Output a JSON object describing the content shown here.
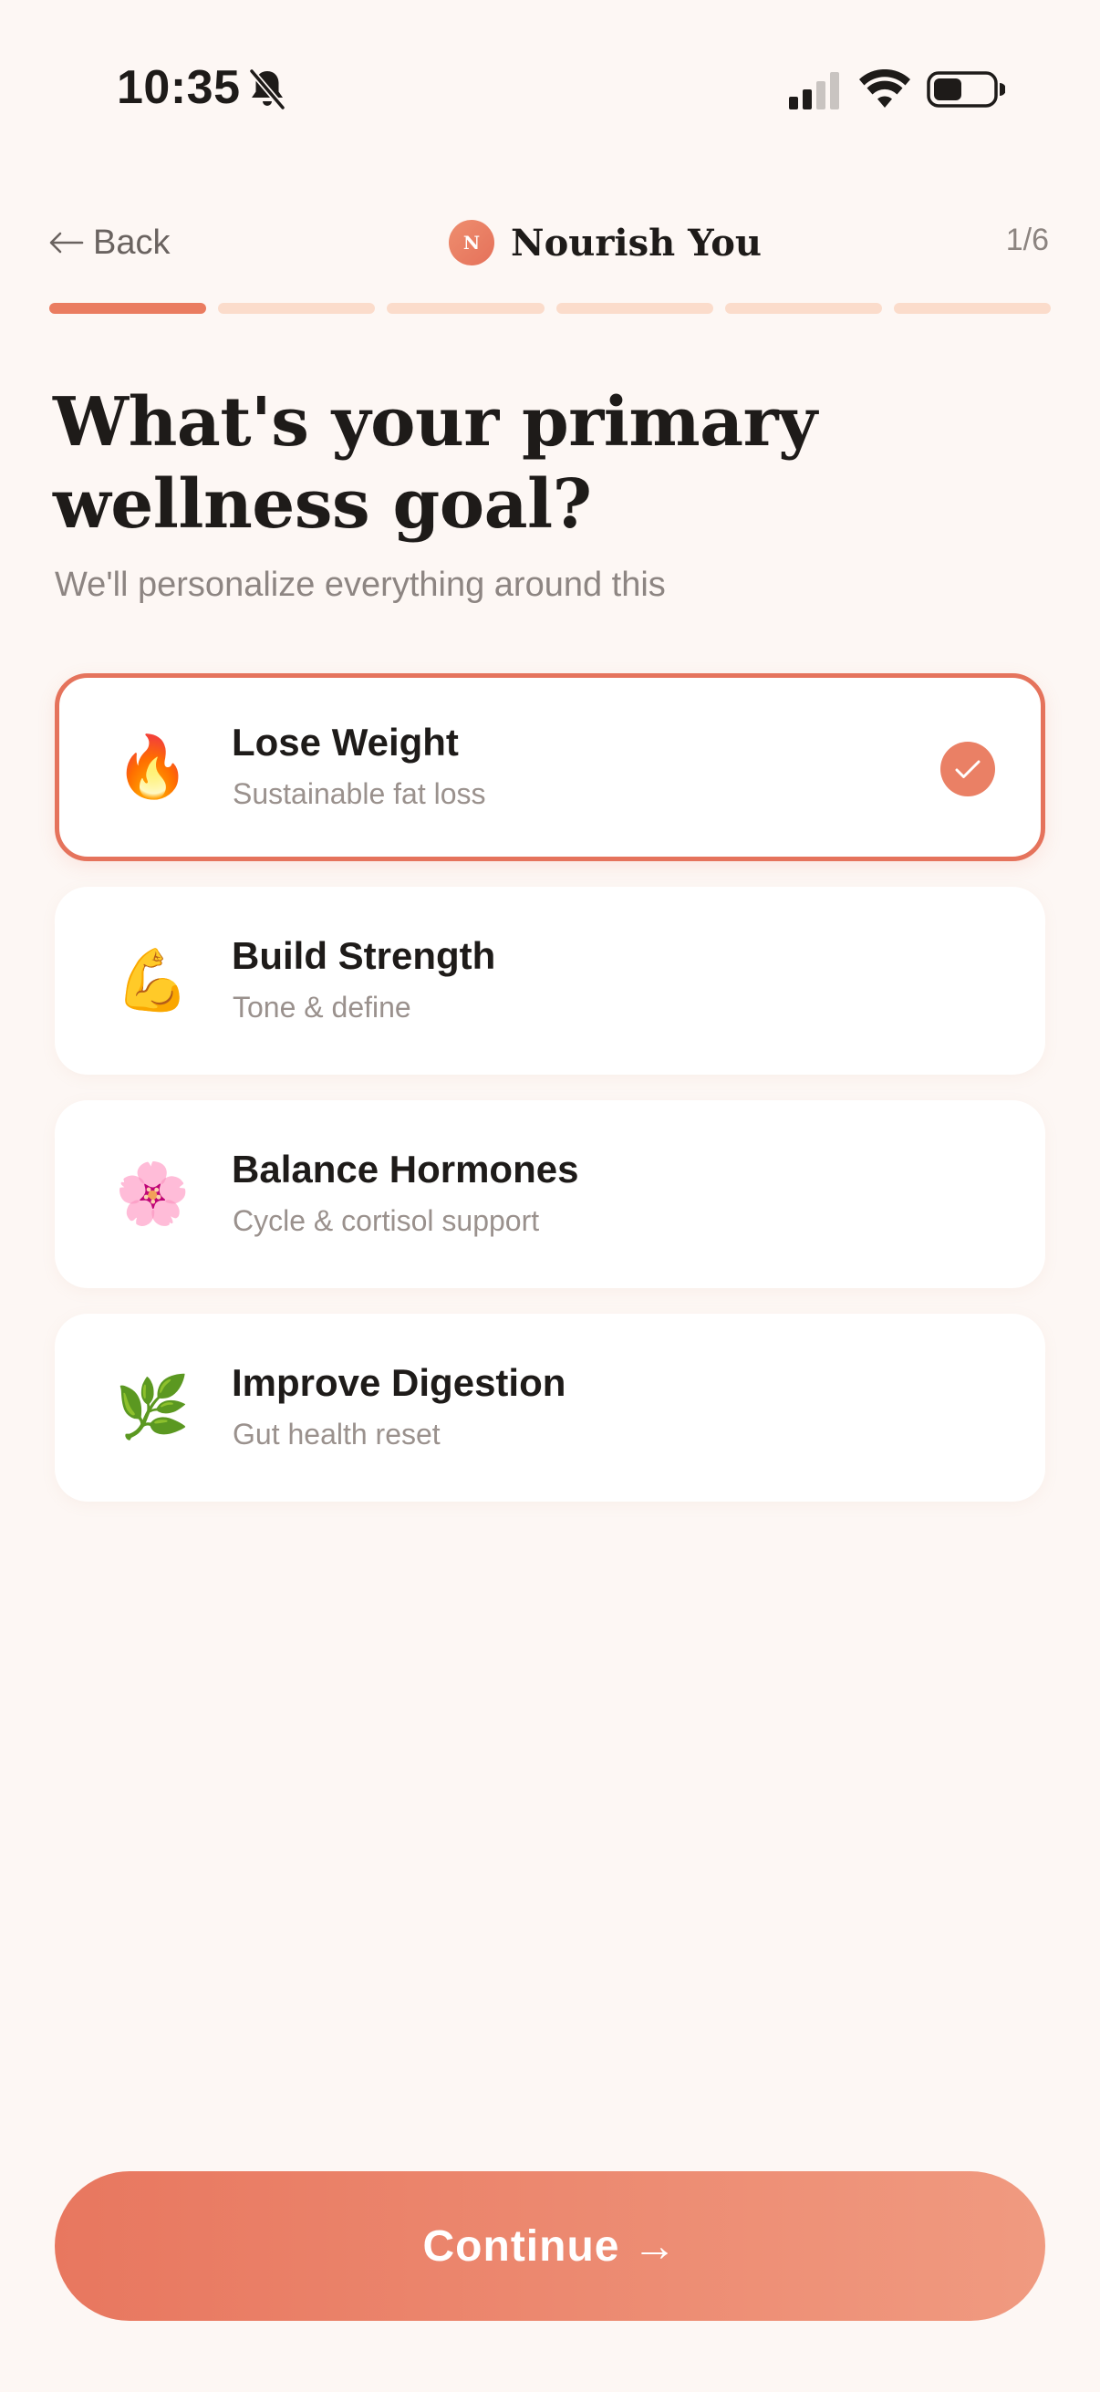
{
  "status_bar": {
    "time": "10:35",
    "icons": [
      "bell-slash-icon",
      "cellular-signal-icon",
      "wifi-icon",
      "battery-icon"
    ]
  },
  "header": {
    "back_label": "Back",
    "brand_initial": "N",
    "brand_name": "Nourish You",
    "step_indicator": "1/6"
  },
  "progress": {
    "total_steps": 6,
    "current_step": 1
  },
  "question": {
    "title": "What's your primary wellness goal?",
    "subtitle": "We'll personalize everything around this"
  },
  "options": [
    {
      "emoji": "🔥",
      "icon": "fire-icon",
      "title": "Lose Weight",
      "subtitle": "Sustainable fat loss",
      "selected": true
    },
    {
      "emoji": "💪",
      "icon": "flexed-biceps-icon",
      "title": "Build Strength",
      "subtitle": "Tone & define",
      "selected": false
    },
    {
      "emoji": "🌸",
      "icon": "cherry-blossom-icon",
      "title": "Balance Hormones",
      "subtitle": "Cycle & cortisol support",
      "selected": false
    },
    {
      "emoji": "🌿",
      "icon": "herb-icon",
      "title": "Improve Digestion",
      "subtitle": "Gut health reset",
      "selected": false
    }
  ],
  "footer": {
    "continue_label": "Continue",
    "continue_arrow": "→"
  },
  "colors": {
    "background": "#fdf7f4",
    "accent": "#e5735c",
    "progress_inactive": "#fbdccb"
  }
}
